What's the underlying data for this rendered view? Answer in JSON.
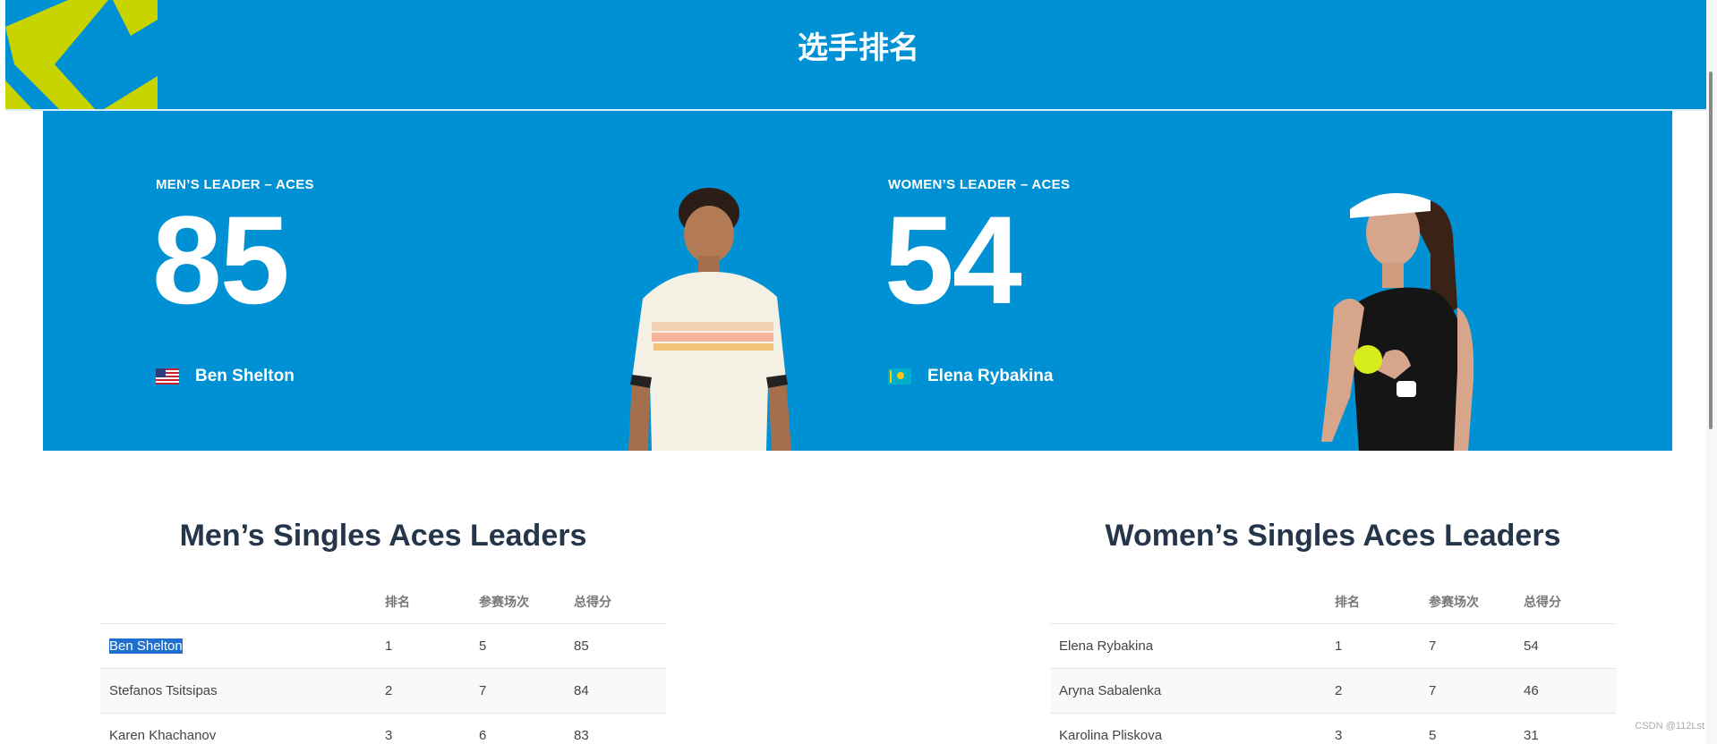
{
  "header": {
    "title": "选手排名"
  },
  "hero": {
    "men": {
      "label": "MEN’S LEADER – ACES",
      "value": "85",
      "player": "Ben Shelton",
      "flag": "us-flag"
    },
    "women": {
      "label": "WOMEN’S LEADER – ACES",
      "value": "54",
      "player": "Elena Rybakina",
      "flag": "kz-flag"
    }
  },
  "tables": {
    "men": {
      "title": "Men’s Singles Aces Leaders",
      "columns": [
        "",
        "排名",
        "参赛场次",
        "总得分"
      ],
      "rows": [
        [
          "Ben Shelton",
          "1",
          "5",
          "85"
        ],
        [
          "Stefanos Tsitsipas",
          "2",
          "7",
          "84"
        ],
        [
          "Karen Khachanov",
          "3",
          "6",
          "83"
        ]
      ]
    },
    "women": {
      "title": "Women’s Singles Aces Leaders",
      "columns": [
        "",
        "排名",
        "参赛场次",
        "总得分"
      ],
      "rows": [
        [
          "Elena Rybakina",
          "1",
          "7",
          "54"
        ],
        [
          "Aryna Sabalenka",
          "2",
          "7",
          "46"
        ],
        [
          "Karolina Pliskova",
          "3",
          "5",
          "31"
        ]
      ]
    }
  },
  "watermark": "CSDN @112Lst",
  "colors": {
    "brand_blue": "#0090d4",
    "accent_lime": "#c8d400",
    "title_navy": "#25364a",
    "selection": "#1f6fd0"
  }
}
